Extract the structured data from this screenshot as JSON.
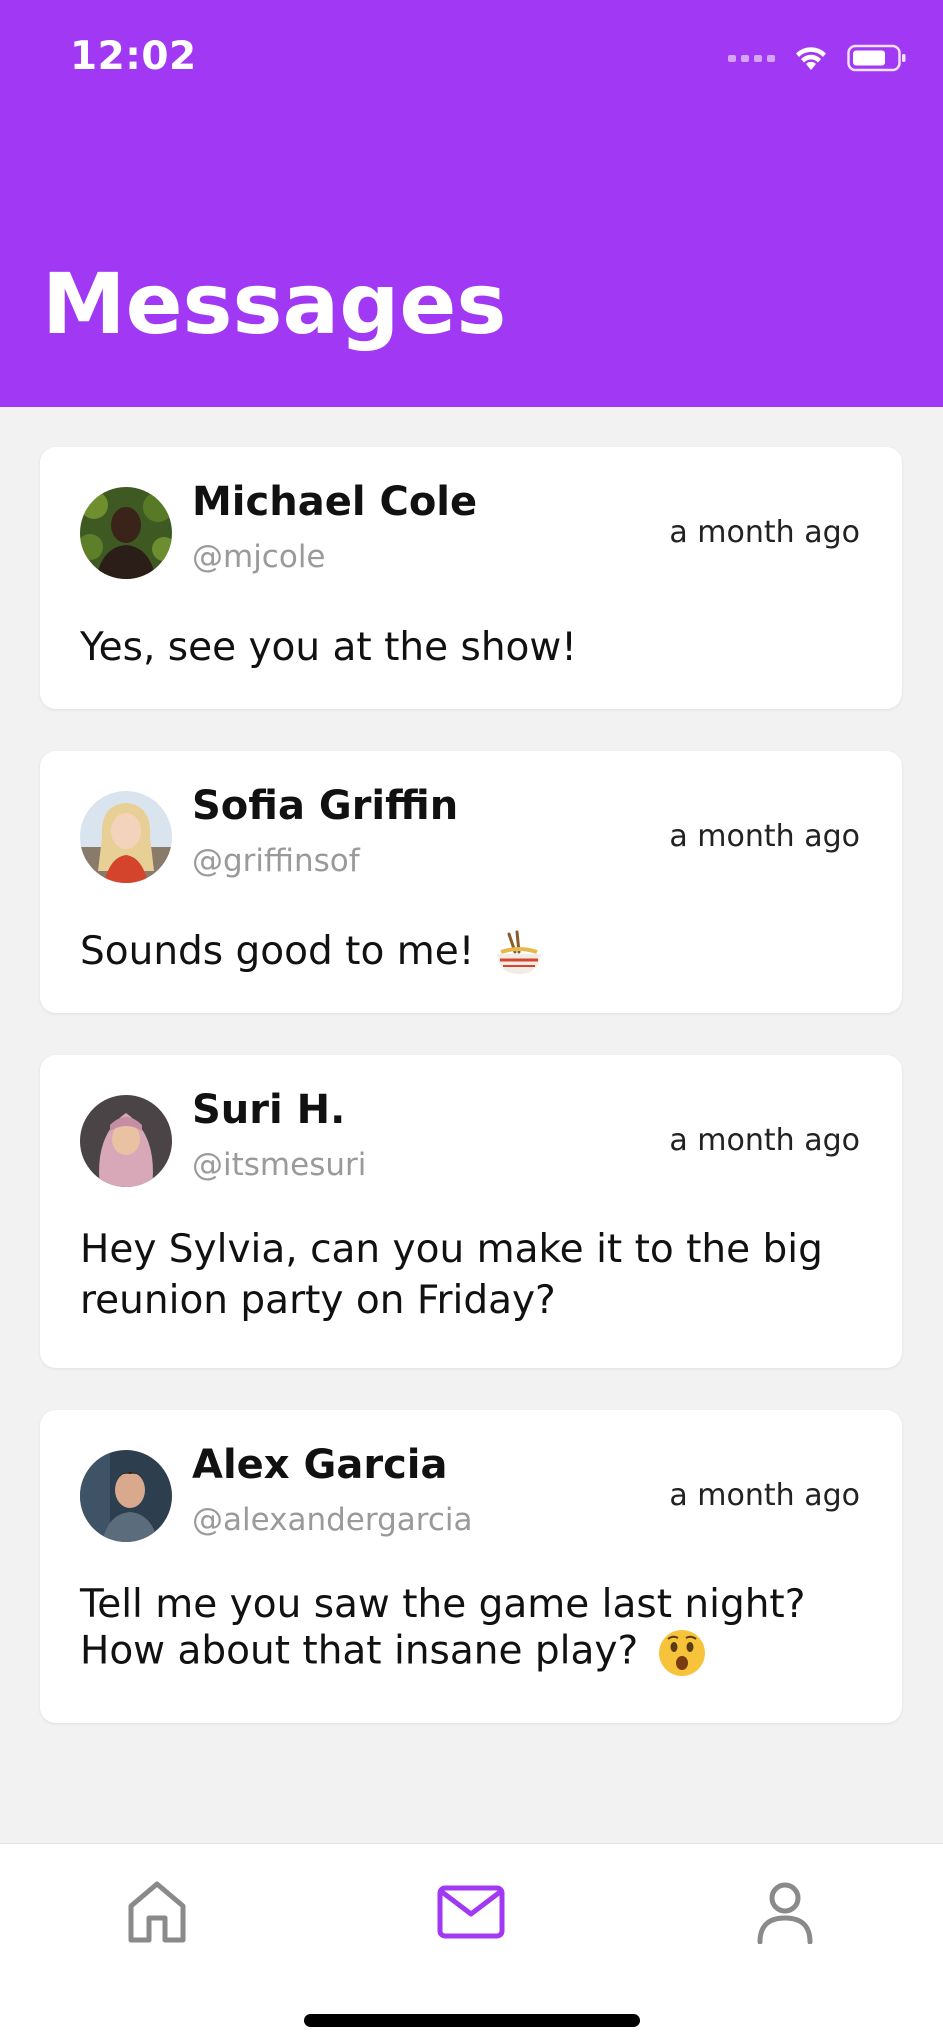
{
  "status_bar": {
    "time": "12:02"
  },
  "header": {
    "title": "Messages"
  },
  "messages": [
    {
      "name": "Michael Cole",
      "handle": "@mjcole",
      "time": "a month ago",
      "text": "Yes, see you at the show!"
    },
    {
      "name": "Sofia Griffin",
      "handle": "@griffinsof",
      "time": "a month ago",
      "text": "Sounds good to me!",
      "emoji": "noodle-bowl-emoji"
    },
    {
      "name": "Suri H.",
      "handle": "@itsmesuri",
      "time": "a month ago",
      "text": "Hey Sylvia, can you make it to the big reunion party on Friday?"
    },
    {
      "name": "Alex Garcia",
      "handle": "@alexandergarcia",
      "time": "a month ago",
      "text": "Tell me you saw the game last night? How about that insane play?",
      "emoji": "astonished-face-emoji"
    }
  ],
  "tabs": [
    {
      "icon": "home-icon",
      "active": false
    },
    {
      "icon": "mail-icon",
      "active": true
    },
    {
      "icon": "profile-icon",
      "active": false
    }
  ],
  "colors": {
    "accent": "#a139f4",
    "background": "#f2f2f2",
    "inactive_icon": "#8a8a8a"
  }
}
